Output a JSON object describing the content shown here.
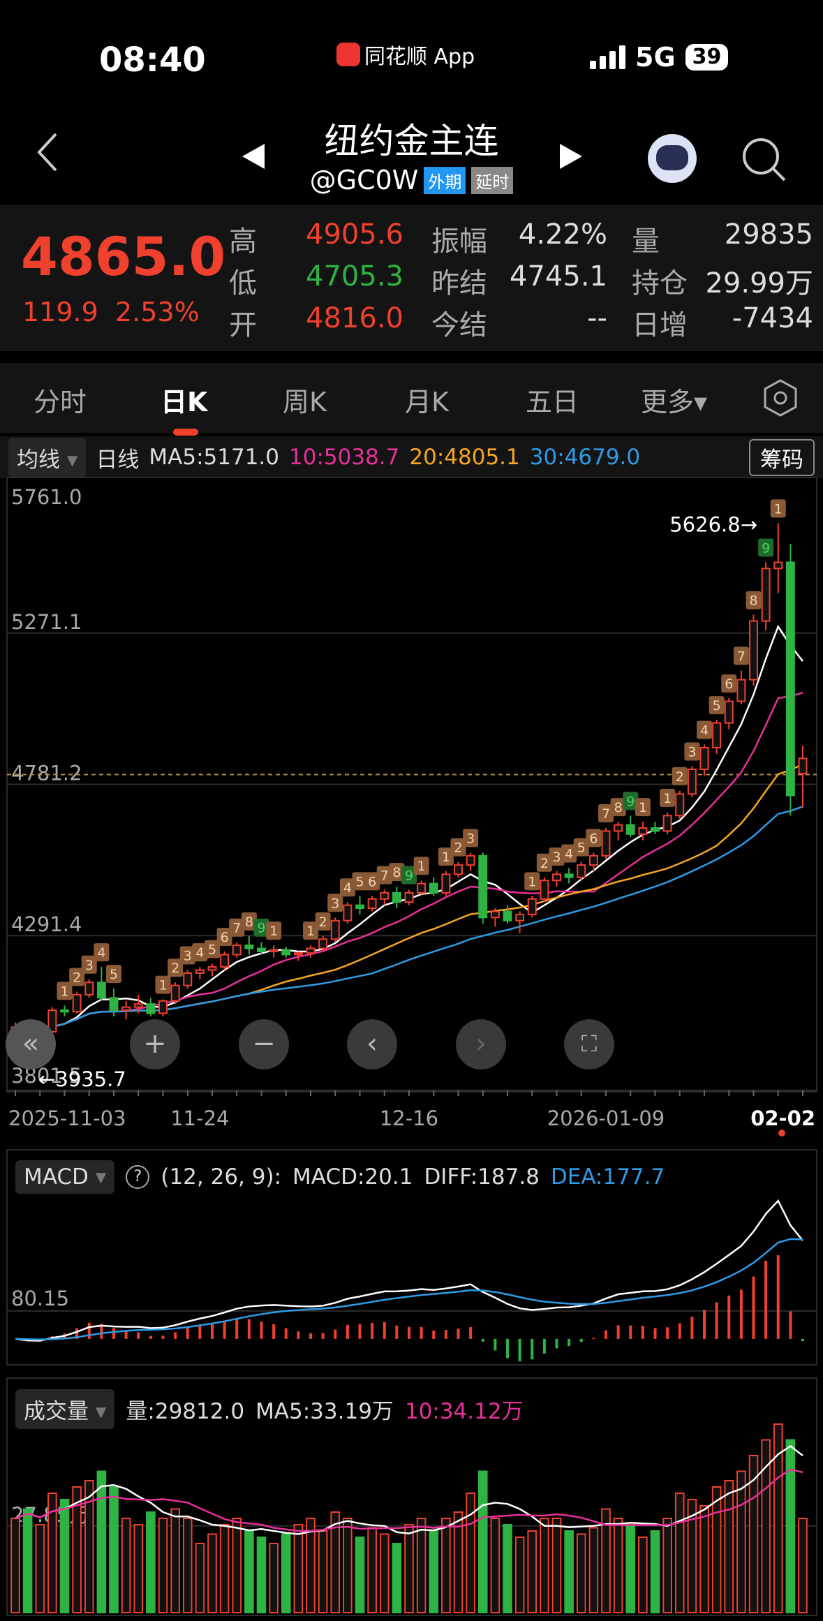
{
  "status": {
    "time": "08:40",
    "app": "同花顺 App",
    "network": "5G",
    "battery": "39"
  },
  "header": {
    "title": "纽约金主连",
    "code": "@GC0W",
    "tag_market": "外期",
    "tag_delay": "延时"
  },
  "quote": {
    "price": "4865.0",
    "change": "119.9",
    "change_pct": "2.53%",
    "rows": [
      [
        {
          "l": "高",
          "v": "4905.6",
          "c": "#f0402e"
        },
        {
          "l": "振幅",
          "v": "4.22%",
          "c": "#ddd"
        },
        {
          "l": "量",
          "v": "29835",
          "c": "#ddd"
        }
      ],
      [
        {
          "l": "低",
          "v": "4705.3",
          "c": "#2fb344"
        },
        {
          "l": "昨结",
          "v": "4745.1",
          "c": "#ddd"
        },
        {
          "l": "持仓",
          "v": "29.99万",
          "c": "#ddd"
        }
      ],
      [
        {
          "l": "开",
          "v": "4816.0",
          "c": "#f0402e"
        },
        {
          "l": "今结",
          "v": "--",
          "c": "#ddd"
        },
        {
          "l": "日增",
          "v": "-7434",
          "c": "#ddd"
        }
      ]
    ]
  },
  "tabs": [
    "分时",
    "日K",
    "周K",
    "月K",
    "五日",
    "更多▾"
  ],
  "ma_legend": {
    "selector": "均线",
    "period": "日线",
    "ma5": "MA5:5171.0",
    "ma10": "10:5038.7",
    "ma20": "20:4805.1",
    "ma30": "30:4679.0",
    "chips": "筹码"
  },
  "colors": {
    "up": "#f0402e",
    "down": "#2fb344",
    "ma5": "#ffffff",
    "ma10": "#e8309a",
    "ma20": "#f5a623",
    "ma30": "#2e9be6"
  },
  "chart_data": {
    "type": "candlestick",
    "y_ticks": [
      "5761.0",
      "5271.1",
      "4781.2",
      "4291.4",
      "3801.5"
    ],
    "ylim": [
      3801.5,
      5761.0
    ],
    "high_marker": "5626.8→",
    "low_marker": "←3935.7",
    "x_labels": [
      {
        "i": 0,
        "t": "2025-11-03"
      },
      {
        "i": 15,
        "t": "11-24"
      },
      {
        "i": 32,
        "t": "12-16"
      },
      {
        "i": 48,
        "t": "2026-01-09"
      },
      {
        "i": 64,
        "t": "02-02"
      }
    ],
    "ohlcv": [
      [
        3990,
        4010,
        3960,
        3995,
        30
      ],
      [
        3995,
        4000,
        3935.7,
        3960,
        33
      ],
      [
        3960,
        3990,
        3950,
        3980,
        28
      ],
      [
        3980,
        4060,
        3975,
        4050,
        38
      ],
      [
        4050,
        4065,
        4030,
        4045,
        36
      ],
      [
        4045,
        4110,
        4040,
        4100,
        40
      ],
      [
        4100,
        4150,
        4090,
        4140,
        42
      ],
      [
        4140,
        4190,
        4080,
        4090,
        45
      ],
      [
        4090,
        4120,
        4030,
        4050,
        40
      ],
      [
        4050,
        4080,
        4020,
        4060,
        30
      ],
      [
        4060,
        4100,
        4040,
        4070,
        28
      ],
      [
        4070,
        4090,
        4030,
        4040,
        32
      ],
      [
        4040,
        4085,
        4030,
        4080,
        30
      ],
      [
        4080,
        4140,
        4070,
        4130,
        33
      ],
      [
        4130,
        4180,
        4120,
        4170,
        30
      ],
      [
        4170,
        4190,
        4150,
        4180,
        22
      ],
      [
        4180,
        4200,
        4160,
        4190,
        25
      ],
      [
        4190,
        4240,
        4180,
        4230,
        28
      ],
      [
        4230,
        4270,
        4220,
        4260,
        30
      ],
      [
        4260,
        4290,
        4230,
        4250,
        26
      ],
      [
        4250,
        4270,
        4230,
        4240,
        24
      ],
      [
        4240,
        4260,
        4220,
        4245,
        22
      ],
      [
        4245,
        4255,
        4220,
        4230,
        25
      ],
      [
        4230,
        4240,
        4210,
        4235,
        28
      ],
      [
        4235,
        4260,
        4220,
        4250,
        30
      ],
      [
        4250,
        4290,
        4240,
        4280,
        26
      ],
      [
        4280,
        4350,
        4270,
        4340,
        32
      ],
      [
        4340,
        4400,
        4330,
        4390,
        30
      ],
      [
        4390,
        4420,
        4360,
        4380,
        24
      ],
      [
        4380,
        4420,
        4370,
        4410,
        27
      ],
      [
        4410,
        4440,
        4390,
        4430,
        25
      ],
      [
        4430,
        4450,
        4380,
        4400,
        22
      ],
      [
        4400,
        4440,
        4390,
        4430,
        28
      ],
      [
        4430,
        4470,
        4420,
        4460,
        30
      ],
      [
        4460,
        4480,
        4420,
        4430,
        26
      ],
      [
        4430,
        4500,
        4420,
        4490,
        30
      ],
      [
        4490,
        4530,
        4480,
        4520,
        32
      ],
      [
        4520,
        4560,
        4500,
        4550,
        38
      ],
      [
        4550,
        4560,
        4330,
        4350,
        45
      ],
      [
        4350,
        4380,
        4320,
        4370,
        30
      ],
      [
        4370,
        4390,
        4330,
        4340,
        28
      ],
      [
        4340,
        4370,
        4300,
        4360,
        24
      ],
      [
        4360,
        4420,
        4350,
        4410,
        26
      ],
      [
        4410,
        4480,
        4400,
        4470,
        30
      ],
      [
        4470,
        4500,
        4450,
        4490,
        30
      ],
      [
        4490,
        4510,
        4460,
        4480,
        26
      ],
      [
        4480,
        4530,
        4470,
        4520,
        25
      ],
      [
        4520,
        4560,
        4500,
        4550,
        27
      ],
      [
        4550,
        4640,
        4540,
        4630,
        33
      ],
      [
        4630,
        4660,
        4600,
        4650,
        30
      ],
      [
        4650,
        4680,
        4610,
        4620,
        28
      ],
      [
        4620,
        4660,
        4600,
        4640,
        24
      ],
      [
        4640,
        4660,
        4620,
        4630,
        26
      ],
      [
        4630,
        4690,
        4620,
        4680,
        30
      ],
      [
        4680,
        4760,
        4670,
        4750,
        38
      ],
      [
        4750,
        4840,
        4740,
        4830,
        36
      ],
      [
        4830,
        4910,
        4810,
        4900,
        34
      ],
      [
        4900,
        4990,
        4880,
        4980,
        40
      ],
      [
        4980,
        5060,
        4960,
        5050,
        42
      ],
      [
        5050,
        5150,
        5040,
        5120,
        45
      ],
      [
        5120,
        5330,
        5100,
        5310,
        50
      ],
      [
        5310,
        5500,
        5280,
        5480,
        55
      ],
      [
        5480,
        5626.8,
        5400,
        5500,
        60
      ],
      [
        5500,
        5560,
        4680,
        4745.1,
        55
      ],
      [
        4816,
        4905.6,
        4705.3,
        4865,
        30
      ]
    ]
  },
  "macd": {
    "selector": "MACD",
    "help": "?",
    "params": "(12, 26, 9):",
    "macd": "MACD:20.1",
    "diff": "DIFF:187.8",
    "dea": "DEA:177.7",
    "axis": "80.15"
  },
  "volume": {
    "selector": "成交量",
    "vol": "量:29812.0",
    "ma5": "MA5:33.19万",
    "ma10": "10:34.12万",
    "axis": "27.85万"
  }
}
